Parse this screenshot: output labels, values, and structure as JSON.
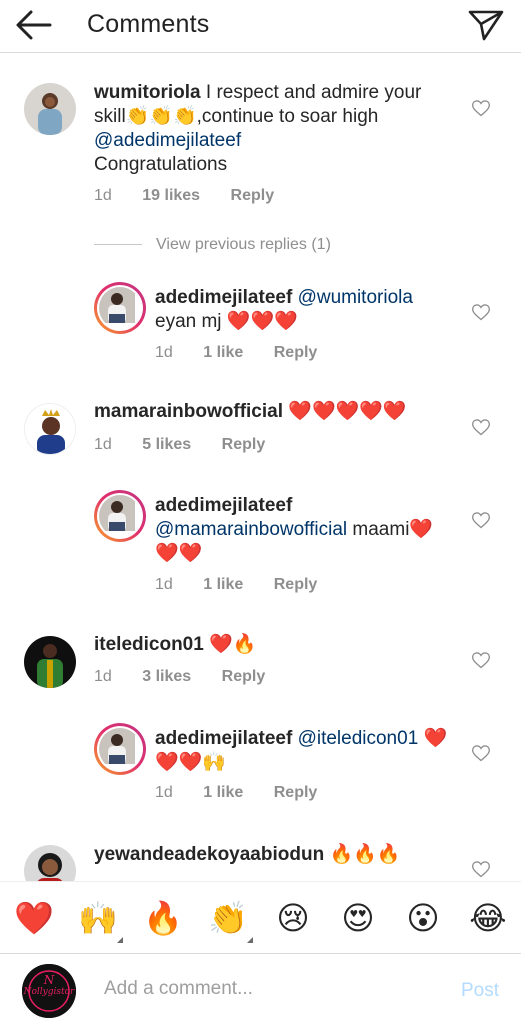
{
  "header": {
    "title": "Comments"
  },
  "comments": [
    {
      "username": "wumitoriola",
      "text_before": "I respect and admire your skill",
      "emojis": "👏👏👏",
      "text_after": ",continue to soar high",
      "mention": "@adedimejilateef",
      "text_tail": "Congratulations",
      "time": "1d",
      "likes": "19 likes",
      "reply": "Reply"
    },
    {
      "view_previous": "View previous replies (1)"
    },
    {
      "username": "adedimejilateef",
      "mention": "@wumitoriola",
      "text": "eyan mj",
      "emojis": "❤️❤️❤️",
      "time": "1d",
      "likes": "1 like",
      "reply": "Reply"
    },
    {
      "username": "mamarainbowofficial",
      "emojis": "❤️❤️❤️❤️❤️",
      "time": "1d",
      "likes": "5 likes",
      "reply": "Reply"
    },
    {
      "username": "adedimejilateef",
      "mention": "@mamarainbowofficial",
      "text": "maami",
      "emojis": "❤️",
      "emojis_line2": "❤️❤️",
      "time": "1d",
      "likes": "1 like",
      "reply": "Reply"
    },
    {
      "username": "iteledicon01",
      "emojis": "❤️🔥",
      "time": "1d",
      "likes": "3 likes",
      "reply": "Reply"
    },
    {
      "username": "adedimejilateef",
      "mention": "@iteledicon01",
      "emojis": "❤️",
      "emojis_line2": "❤️❤️🙌",
      "time": "1d",
      "likes": "1 like",
      "reply": "Reply"
    },
    {
      "username": "yewandeadekoyaabiodun",
      "emojis": "🔥🔥🔥"
    }
  ],
  "quick_reactions": [
    "❤️",
    "🙌",
    "🔥",
    "👏",
    "😢",
    "😍",
    "😮",
    "😂"
  ],
  "composer": {
    "placeholder": "Add a comment...",
    "post_label": "Post",
    "avatar_text": "Nollygistor"
  },
  "icons": {
    "back": "arrow-left-icon",
    "send": "paper-plane-icon",
    "like": "heart-outline-icon"
  },
  "colors": {
    "mention": "#003569",
    "meta": "#8e8e8e",
    "post_disabled": "#b3dbff"
  }
}
